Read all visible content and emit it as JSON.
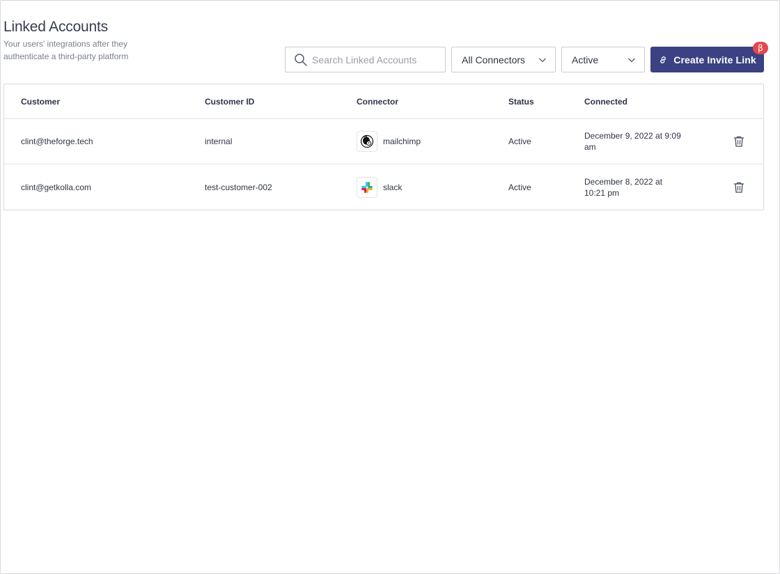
{
  "header": {
    "title": "Linked Accounts",
    "subtitle": "Your users' integrations after they authenticate a third-party platform"
  },
  "toolbar": {
    "search_placeholder": "Search Linked Accounts",
    "connector_filter": "All Connectors",
    "status_filter": "Active",
    "create_label": "Create Invite Link",
    "beta_badge": "β"
  },
  "table": {
    "columns": [
      "Customer",
      "Customer ID",
      "Connector",
      "Status",
      "Connected"
    ],
    "rows": [
      {
        "customer": "clint@theforge.tech",
        "customer_id": "internal",
        "connector": "mailchimp",
        "status": "Active",
        "connected": "December 9, 2022 at 9:09 am"
      },
      {
        "customer": "clint@getkolla.com",
        "customer_id": "test-customer-002",
        "connector": "slack",
        "status": "Active",
        "connected": "December 8, 2022 at 10:21 pm"
      }
    ]
  },
  "colors": {
    "primary": "#3c4183",
    "beta": "#e5484d",
    "border": "#d8d9de"
  }
}
